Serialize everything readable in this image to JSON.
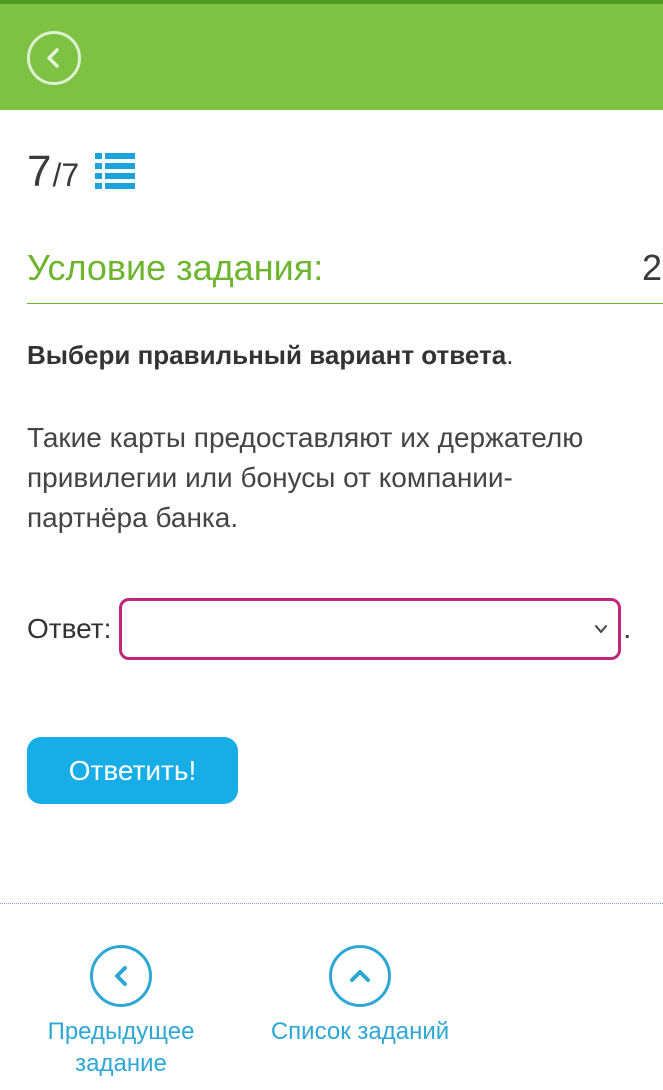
{
  "header": {
    "back_icon": "chevron-left-icon"
  },
  "progress": {
    "current": "7",
    "total": "/7",
    "list_icon": "list-icon"
  },
  "task": {
    "condition_title": "Условие задания:",
    "points": "2",
    "instruction_bold": "Выбери правильный вариант ответа",
    "instruction_end": ".",
    "question": "Такие карты предоставляют их держателю привилегии или бонусы от компании-партнёра банка.",
    "answer_label": "Ответ:",
    "answer_value": "",
    "answer_suffix": "."
  },
  "submit": {
    "label": "Ответить!"
  },
  "footer": {
    "prev_label_line1": "Предыдущее",
    "prev_label_line2": "задание",
    "list_label": "Список заданий"
  },
  "colors": {
    "header_green": "#7dc243",
    "title_green": "#6db52f",
    "select_border": "#c0267a",
    "button_blue": "#17aee8",
    "nav_blue": "#2da7d6"
  }
}
